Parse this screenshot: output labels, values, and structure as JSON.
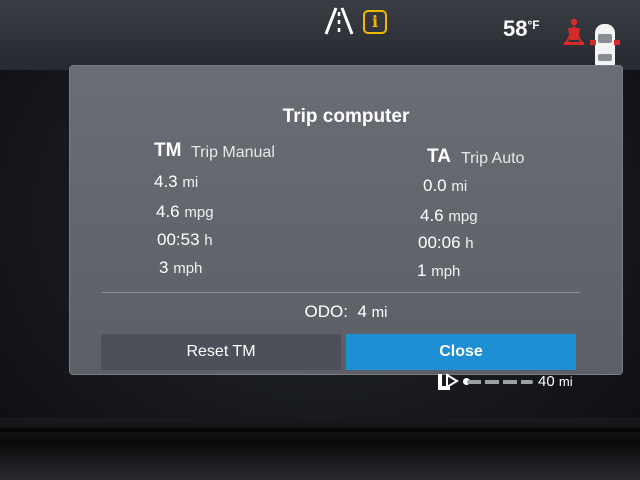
{
  "status_bar": {
    "temperature": "58",
    "temperature_unit": "°F"
  },
  "dialog": {
    "title": "Trip computer",
    "trip_manual": {
      "code": "TM",
      "name": "Trip Manual",
      "distance": "4.3",
      "distance_unit": "mi",
      "economy": "4.6",
      "economy_unit": "mpg",
      "time": "00:53",
      "time_unit": "h",
      "speed": "3",
      "speed_unit": "mph"
    },
    "trip_auto": {
      "code": "TA",
      "name": "Trip Auto",
      "distance": "0.0",
      "distance_unit": "mi",
      "economy": "4.6",
      "economy_unit": "mpg",
      "time": "00:06",
      "time_unit": "h",
      "speed": "1",
      "speed_unit": "mph"
    },
    "odometer_label": "ODO:",
    "odometer_value": "4",
    "odometer_unit": "mi",
    "reset_button": "Reset TM",
    "close_button": "Close"
  },
  "nav": {
    "range_value": "40",
    "range_unit": "mi"
  },
  "icons": {
    "lane": "lane-assist-icon",
    "info": "info-icon",
    "seatbelt": "seatbelt-warning-icon",
    "car": "car-doors-icon",
    "nav": "nav-route-icon"
  },
  "colors": {
    "accent": "#1e8fd3",
    "info_warning": "#f2b705",
    "seatbelt_warning": "#d82a2a"
  }
}
